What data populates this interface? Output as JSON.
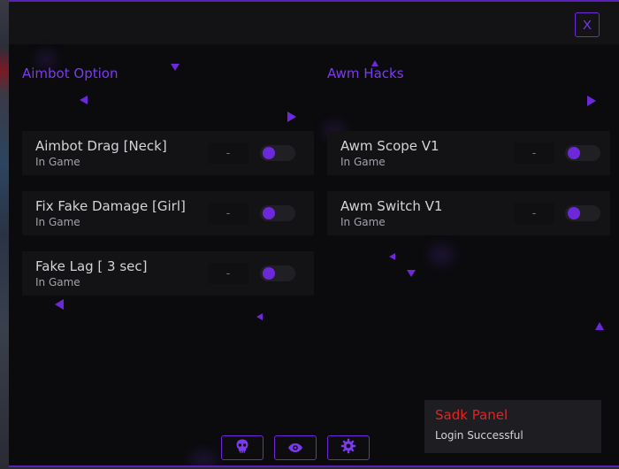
{
  "window": {
    "close_label": "X"
  },
  "sections": {
    "left_title": "Aimbot Option",
    "right_title": "Awm Hacks"
  },
  "options_left": [
    {
      "name": "Aimbot Drag [Neck]",
      "sub": "In Game",
      "key": "-",
      "enabled": false
    },
    {
      "name": "Fix Fake Damage [Girl]",
      "sub": "In Game",
      "key": "-",
      "enabled": false
    },
    {
      "name": "Fake Lag [ 3 sec]",
      "sub": "In Game",
      "key": "-",
      "enabled": false
    }
  ],
  "options_right": [
    {
      "name": "Awm Scope V1",
      "sub": "In Game",
      "key": "-",
      "enabled": false
    },
    {
      "name": "Awm Switch V1",
      "sub": "In Game",
      "key": "-",
      "enabled": false
    }
  ],
  "bottom_icons": [
    "skull-icon",
    "eye-icon",
    "gear-icon"
  ],
  "toast": {
    "title": "Sadk Panel",
    "message": "Login Successful"
  },
  "colors": {
    "accent": "#7c3aed",
    "toast_title": "#dc2626",
    "background": "#0b0b0e"
  }
}
